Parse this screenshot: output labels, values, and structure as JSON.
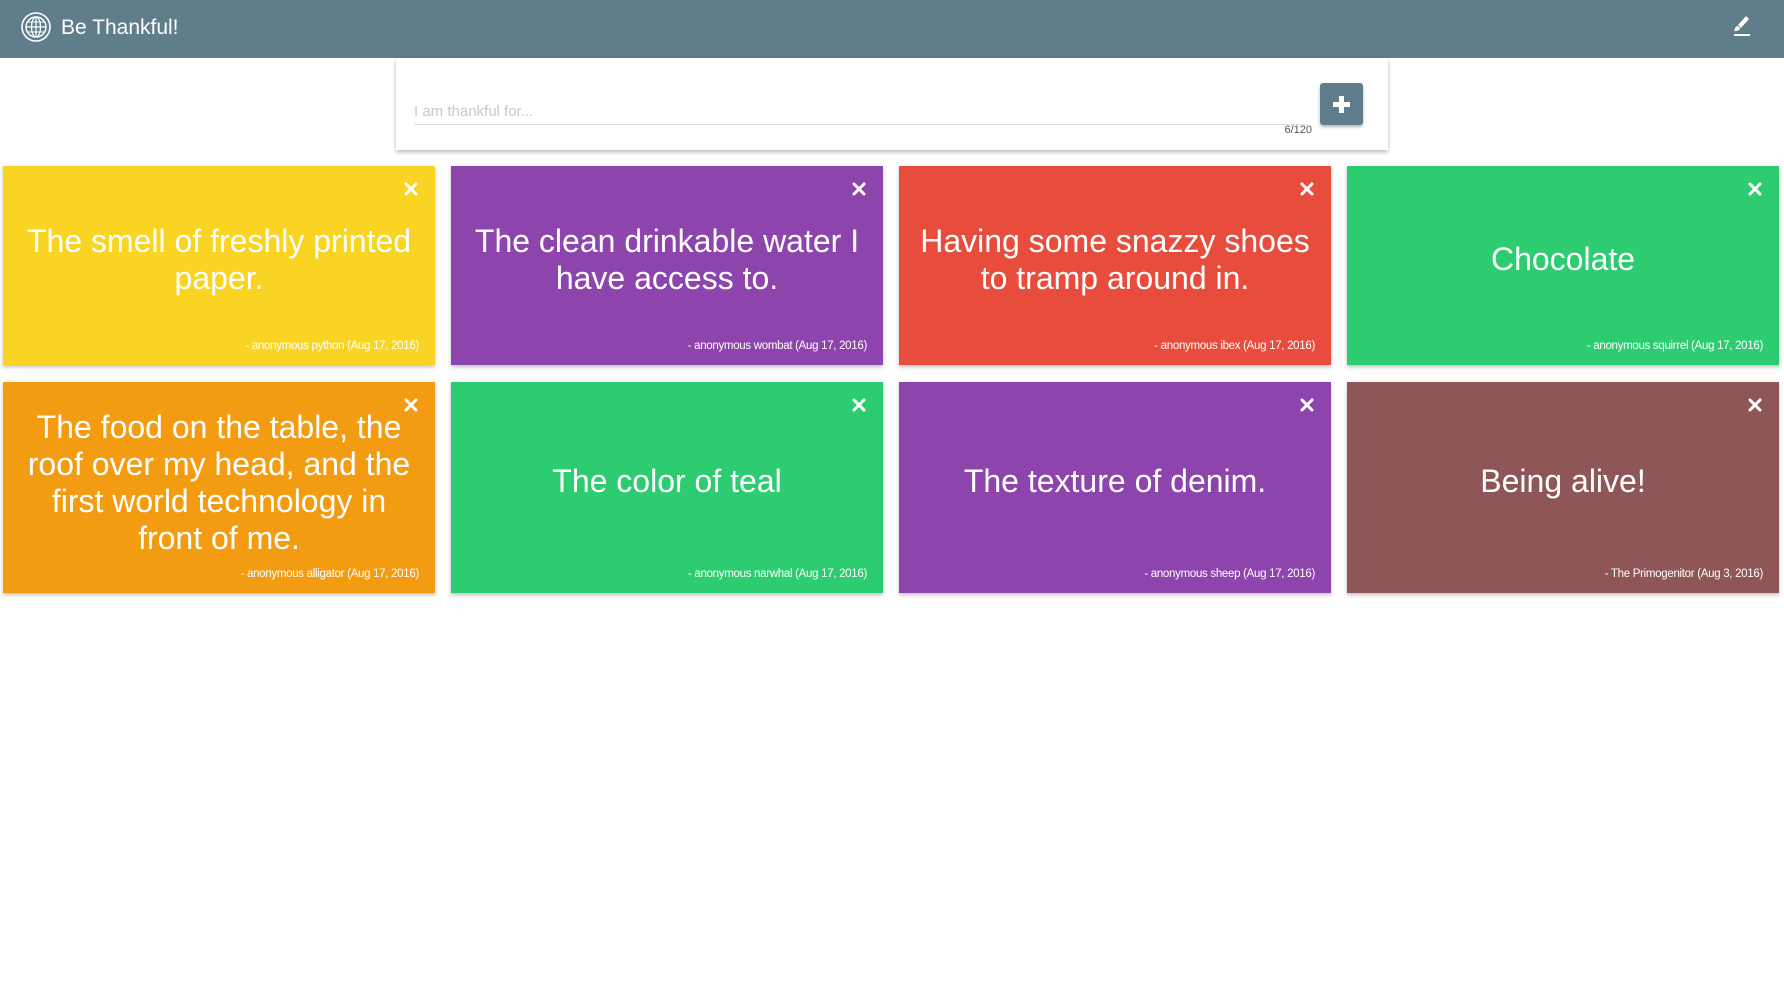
{
  "header": {
    "title": "Be Thankful!",
    "logo_icon": "globe-icon",
    "action_icon": "paint-brush-icon",
    "color": "#607d8b"
  },
  "entry": {
    "placeholder": "I am thankful for...",
    "value": "",
    "counter": "6/120",
    "add_icon": "plus-icon"
  },
  "cards": [
    {
      "text": "The smell of freshly printed paper.",
      "author": "- anonymous python (Aug 17, 2016)",
      "color": "#f9d423"
    },
    {
      "text": "The clean drinkable water I have access to.",
      "author": "- anonymous wombat (Aug 17, 2016)",
      "color": "#8e44ad"
    },
    {
      "text": "Having some snazzy shoes to tramp around in.",
      "author": "- anonymous ibex (Aug 17, 2016)",
      "color": "#e74c3c"
    },
    {
      "text": "Chocolate",
      "author": "- anonymous squirrel (Aug 17, 2016)",
      "color": "#2ecc71"
    },
    {
      "text": "The food on the table, the roof over my head, and the first world technology in front of me.",
      "author": "- anonymous alligator (Aug 17, 2016)",
      "color": "#f39c12"
    },
    {
      "text": "The color of teal",
      "author": "- anonymous narwhal (Aug 17, 2016)",
      "color": "#2ecc71"
    },
    {
      "text": "The texture of denim.",
      "author": "- anonymous sheep (Aug 17, 2016)",
      "color": "#8e44ad"
    },
    {
      "text": "Being alive!",
      "author": "- The Primogenitor (Aug 3, 2016)",
      "color": "#8e5656"
    }
  ]
}
